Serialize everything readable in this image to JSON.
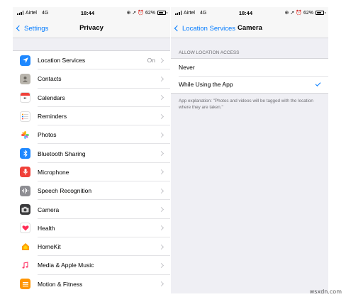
{
  "left_phone": {
    "status": {
      "carrier": "Airtel",
      "network": "4G",
      "time": "18:44",
      "battery": "62%"
    },
    "nav": {
      "back_label": "Settings",
      "title": "Privacy"
    },
    "items": [
      {
        "label": "Location Services",
        "value": "On",
        "icon": "location-arrow-icon",
        "color": "#1e88ff"
      },
      {
        "label": "Contacts",
        "icon": "contacts-icon",
        "color": "#b9b5ad"
      },
      {
        "label": "Calendars",
        "icon": "calendar-icon",
        "color": "#ffffff"
      },
      {
        "label": "Reminders",
        "icon": "reminders-icon",
        "color": "#ffffff"
      },
      {
        "label": "Photos",
        "icon": "photos-icon",
        "color": "#ffffff"
      },
      {
        "label": "Bluetooth Sharing",
        "icon": "bluetooth-icon",
        "color": "#1e88ff"
      },
      {
        "label": "Microphone",
        "icon": "microphone-icon",
        "color": "#f0413a"
      },
      {
        "label": "Speech Recognition",
        "icon": "waveform-icon",
        "color": "#8e8e93"
      },
      {
        "label": "Camera",
        "icon": "camera-icon",
        "color": "#3a3a3c"
      },
      {
        "label": "Health",
        "icon": "heart-icon",
        "color": "#ffffff"
      },
      {
        "label": "HomeKit",
        "icon": "home-icon",
        "color": "#ff9f0a"
      },
      {
        "label": "Media & Apple Music",
        "icon": "music-note-icon",
        "color": "#ff3b6b"
      },
      {
        "label": "Motion & Fitness",
        "icon": "motion-icon",
        "color": "#ff9500"
      }
    ]
  },
  "right_phone": {
    "status": {
      "carrier": "Airtel",
      "network": "4G",
      "time": "18:44",
      "battery": "62%"
    },
    "nav": {
      "back_label": "Location Services",
      "title": "Camera"
    },
    "section_header": "ALLOW LOCATION ACCESS",
    "options": [
      {
        "label": "Never",
        "selected": false
      },
      {
        "label": "While Using the App",
        "selected": true
      }
    ],
    "explanation": "App explanation: \"Photos and videos will be tagged with the location where they are taken.\""
  },
  "watermark": "wsxdn.com",
  "accent": "#007aff"
}
